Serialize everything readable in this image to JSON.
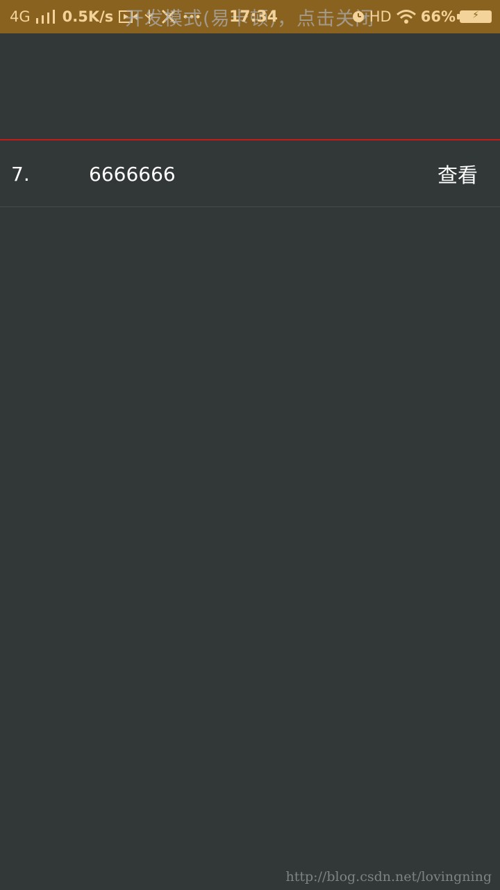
{
  "status_bar": {
    "network": "4G",
    "speed": "0.5K/s",
    "time": "17:34",
    "dev_mode_text": "开发模式(易卡顿)，点击关闭",
    "hd_label": "HD",
    "battery": "66%",
    "icons": [
      "signal-icon",
      "video-icon",
      "usb-icon",
      "tools-icon",
      "more-icon",
      "alarm-icon",
      "wifi-icon",
      "battery-icon"
    ]
  },
  "list": {
    "items": [
      {
        "index": "7.",
        "value": "6666666",
        "action": "查看"
      }
    ]
  },
  "watermark": "http://blog.csdn.net/lovingning",
  "colors": {
    "status_bar_bg": "#8a621f",
    "page_bg": "#313837",
    "divider": "#c41a1a"
  }
}
